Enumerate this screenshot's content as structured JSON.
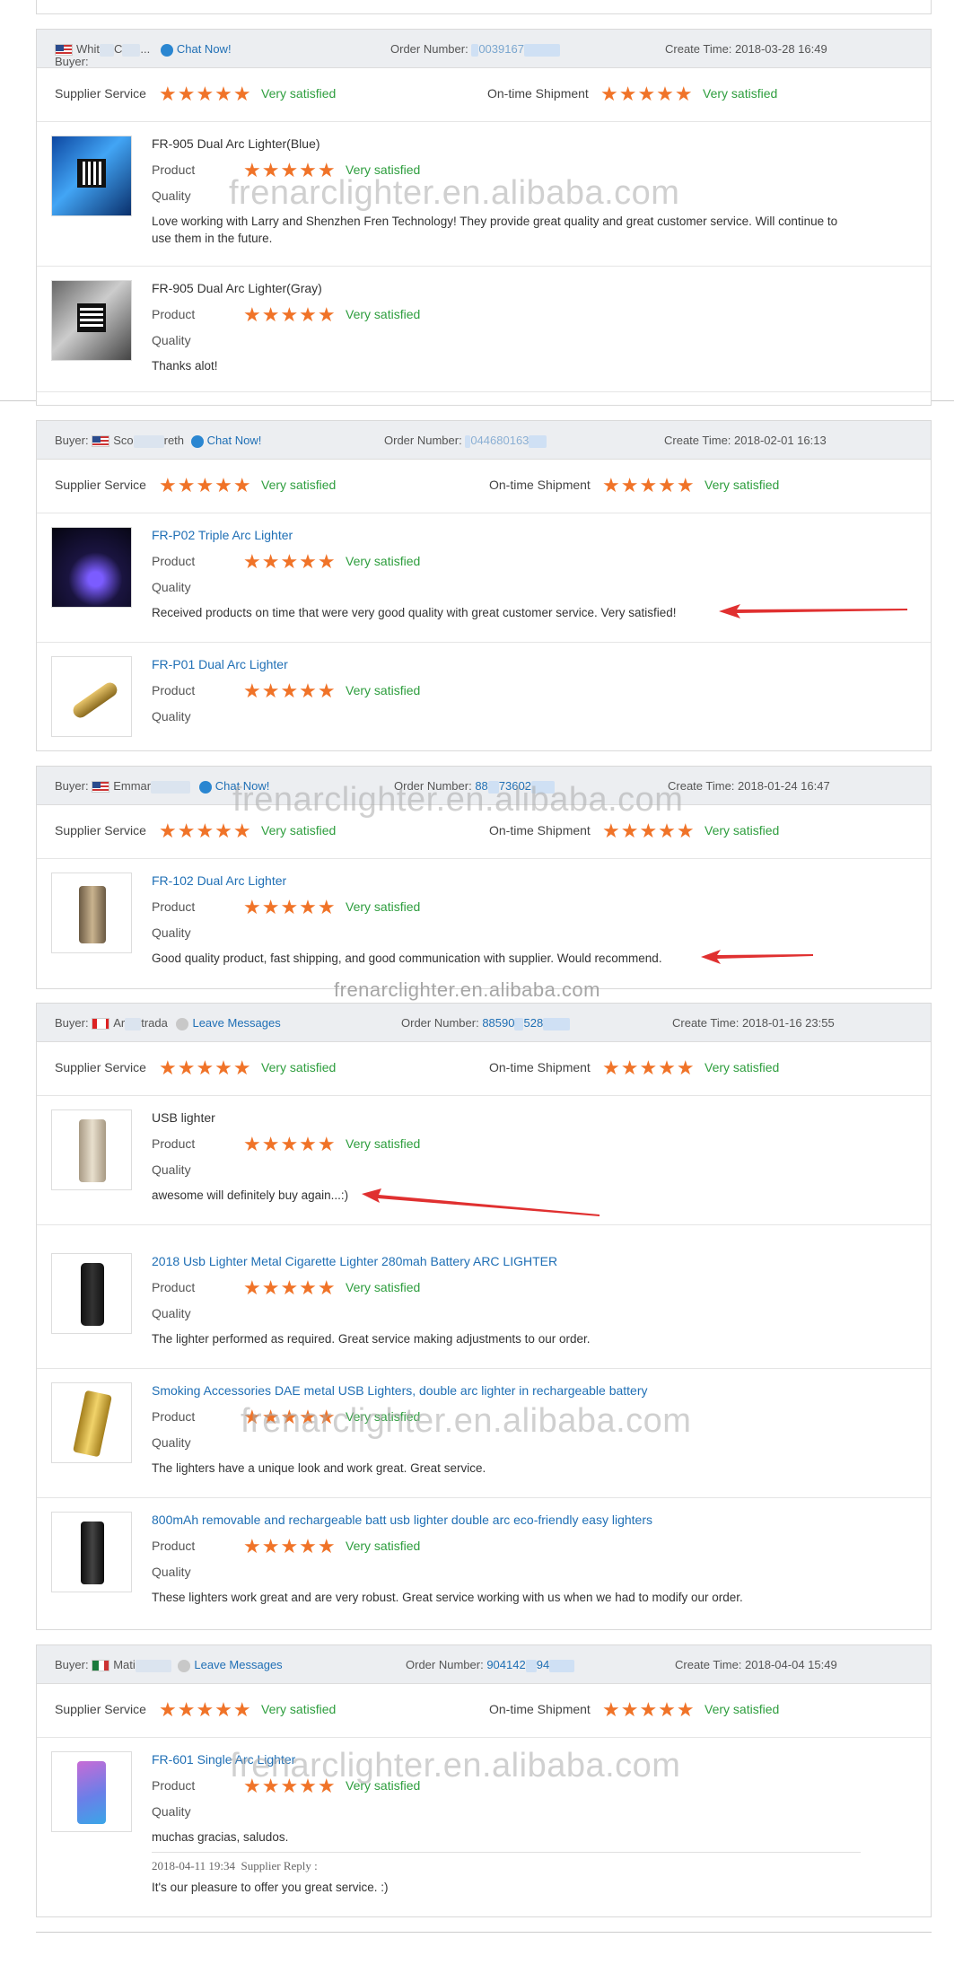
{
  "labels": {
    "buyer": "Buyer:",
    "order_number": "Order Number:",
    "create_time": "Create Time:",
    "supplier_service": "Supplier Service",
    "ontime_shipment": "On-time Shipment",
    "product": "Product",
    "quality": "Quality",
    "very_satisfied": "Very satisfied"
  },
  "colors": {
    "stars": "#f07328",
    "satisfied": "#2e9e3e",
    "link": "#1f6fb5",
    "arrow": "#e03030"
  },
  "watermark": {
    "domain": "frenarclighter.en.alibaba.com",
    "small": "frenarclighter.en.alibaba.com"
  },
  "reviews": [
    {
      "buyer_name_a": "Whit",
      "buyer_name_b": "C",
      "buyer_name_c": "...",
      "contact": "Chat Now!",
      "contact_icon": "chat-icon",
      "order_number": "0039167",
      "create_time": "2018-03-28 16:49",
      "items": [
        {
          "name": "FR-905 Dual Arc Lighter(Blue)",
          "comment_line1": "Love working with Larry and Shenzhen Fren Technology! They provide great quality and great customer service. Will continue to",
          "comment_line2": "use them in the future."
        },
        {
          "name": "FR-905 Dual Arc Lighter(Gray)",
          "comment_line1": "Thanks alot!",
          "comment_line2": ""
        }
      ]
    },
    {
      "buyer_name_a": "Sco",
      "buyer_name_b": "reth",
      "contact": "Chat Now!",
      "contact_icon": "chat-icon",
      "order_number": "044680163",
      "create_time": "2018-02-01 16:13",
      "items": [
        {
          "name": "FR-P02 Triple Arc Lighter",
          "comment_line1": "Received products on time that were very good quality with great customer service. Very satisfied!"
        },
        {
          "name": "FR-P01 Dual Arc Lighter",
          "comment_line1": ""
        }
      ]
    },
    {
      "buyer_name_a": "Emmar",
      "contact": "Chat Now!",
      "contact_icon": "chat-icon",
      "order_number": "88",
      "order_number_b": "73602",
      "create_time": "2018-01-24 16:47",
      "items": [
        {
          "name": "FR-102 Dual Arc Lighter",
          "comment_line1": "Good quality product, fast shipping, and good communication with supplier. Would recommend."
        }
      ]
    },
    {
      "buyer_name_a": "Ar",
      "buyer_name_b": "trada",
      "contact": "Leave Messages",
      "contact_icon": "message-icon",
      "order_number": "88590",
      "order_number_b": "528",
      "create_time": "2018-01-16 23:55",
      "items": [
        {
          "name": "USB lighter",
          "comment_line1": "awesome will definitely buy again...:)"
        },
        {
          "name": "2018 Usb Lighter Metal Cigarette Lighter 280mah Battery ARC LIGHTER",
          "comment_line1": "The lighter performed as required. Great service making adjustments to our order."
        },
        {
          "name": "Smoking Accessories DAE metal USB Lighters, double arc lighter in rechargeable battery",
          "comment_line1": "The lighters have a unique look and work great. Great service."
        },
        {
          "name": "800mAh removable and rechargeable batt usb lighter double arc eco-friendly easy lighters",
          "comment_line1": "These lighters work great and are very robust. Great service working with us when we had to modify our order."
        }
      ]
    },
    {
      "buyer_name_a": "Mati",
      "contact": "Leave Messages",
      "contact_icon": "message-icon",
      "order_number": "904142",
      "order_number_b": "94",
      "create_time": "2018-04-04 15:49",
      "items": [
        {
          "name": "FR-601 Single Arc Lighter",
          "comment_line1": "muchas gracias, saludos."
        }
      ],
      "reply": {
        "time": "2018-04-11 19:34",
        "label": "Supplier Reply :",
        "text": "It's our pleasure to offer you great service. :)"
      }
    }
  ]
}
